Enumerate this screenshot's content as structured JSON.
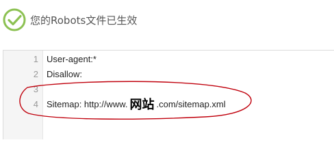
{
  "status": {
    "icon": "check-circle-icon",
    "icon_color": "#8cc152",
    "message": "您的Robots文件已生效"
  },
  "editor": {
    "lines": [
      {
        "num": "1",
        "text": "User-agent:*"
      },
      {
        "num": "2",
        "text": "Disallow:"
      },
      {
        "num": "3",
        "text": ""
      }
    ],
    "sitemap_line": {
      "num": "4",
      "prefix": "Sitemap: http://www.",
      "highlight_word": "网站",
      "suffix": ".com/sitemap.xml"
    }
  },
  "annotation": {
    "ellipse_color": "#c0000c"
  }
}
